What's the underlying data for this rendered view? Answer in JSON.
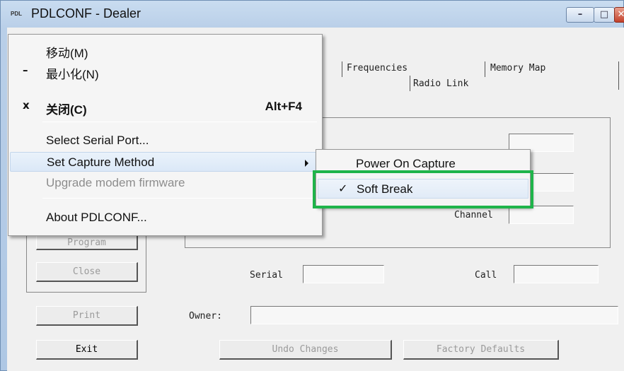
{
  "window": {
    "app_icon_text": "PDL",
    "title": "PDLCONF - Dealer",
    "minimize_glyph": "–",
    "maximize_glyph": "□",
    "close_glyph": "✕"
  },
  "tabs": {
    "frequencies": "Frequencies",
    "memory_map": "Memory Map",
    "radio_link": "Radio Link"
  },
  "fields": {
    "channel_label": "Channel",
    "serial_label": "Serial",
    "call_label": "Call",
    "owner_label": "Owner:"
  },
  "buttons": {
    "program": "Program",
    "close": "Close",
    "print": "Print",
    "exit": "Exit",
    "undo_changes": "Undo Changes",
    "factory_defaults": "Factory Defaults"
  },
  "system_menu": {
    "move": "移动(M)",
    "minimize_glyph": "–",
    "minimize": "最小化(N)",
    "close_glyph": "x",
    "close": "关闭(C)",
    "close_accel": "Alt+F4",
    "select_serial_port": "Select Serial Port...",
    "set_capture_method": "Set Capture Method",
    "upgrade_modem_firmware": "Upgrade modem firmware",
    "about": "About PDLCONF..."
  },
  "capture_submenu": {
    "power_on_capture": "Power On Capture",
    "soft_break_check": "✓",
    "soft_break": "Soft Break"
  },
  "colors": {
    "highlight_outline": "#1fb44a",
    "menu_highlight": "#dbe8f7"
  }
}
